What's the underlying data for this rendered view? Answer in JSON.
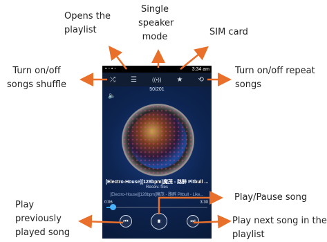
{
  "annotations": {
    "playlist": "Opens the\nplaylist",
    "speaker": "Single\nspeaker\nmode",
    "sim": "SIM card",
    "shuffle": "Turn on/off\nsongs shuffle",
    "repeat": "Turn on/off repeat\nsongs",
    "playpause": "Play/Pause song",
    "previous": "Play\npreviously\nplayed song",
    "next": "Play next song in the\nplaylist"
  },
  "phone": {
    "status_time": "3:34 am",
    "toolbar": {
      "shuffle_icon": "⤮",
      "playlist_icon": "☰",
      "speaker_icon": "((•))",
      "sim_icon": "★",
      "repeat_icon": "⟲"
    },
    "track_count": "50/201",
    "volume_icon": "🔈",
    "song_title": "[Electro-House][128bpm]魔茂 - 路醉 Pitbull ...",
    "artist": "Receiv. files",
    "lyric": "[Electro-House][128bpm]魔茂 - 路醉 Pitbull - Like...",
    "time_current": "0:06",
    "time_total": "3:30",
    "progress": 0.04,
    "controls": {
      "prev": "⏮",
      "play": "⏸",
      "next": "⏭"
    }
  },
  "colors": {
    "arrow": "#e9702a",
    "phone_bg": "#0a1a3a"
  }
}
